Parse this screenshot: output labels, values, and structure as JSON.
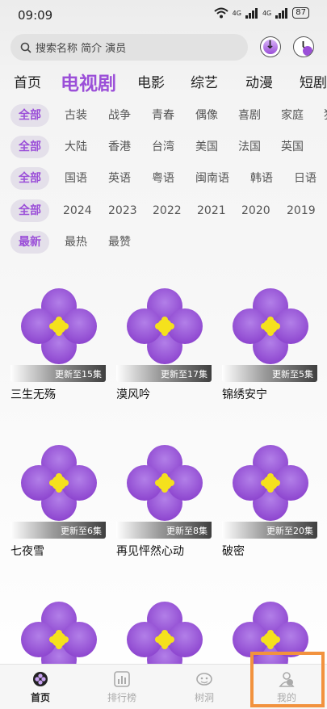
{
  "status_bar": {
    "time": "09:09",
    "network_1": "4G",
    "network_2": "4G",
    "battery": "87"
  },
  "search": {
    "placeholder": "搜索名称 简介 演员"
  },
  "icons": {
    "download": "download-icon",
    "history": "history-clock-icon",
    "search": "search-icon"
  },
  "category_tabs": [
    {
      "label": "首页",
      "active": false
    },
    {
      "label": "电视剧",
      "active": true
    },
    {
      "label": "电影",
      "active": false
    },
    {
      "label": "综艺",
      "active": false
    },
    {
      "label": "动漫",
      "active": false
    },
    {
      "label": "短剧",
      "active": false
    }
  ],
  "filters": {
    "genre": [
      "全部",
      "古装",
      "战争",
      "青春",
      "偶像",
      "喜剧",
      "家庭",
      "犯罪"
    ],
    "region": [
      "全部",
      "大陆",
      "香港",
      "台湾",
      "美国",
      "法国",
      "英国"
    ],
    "language": [
      "全部",
      "国语",
      "英语",
      "粤语",
      "闽南语",
      "韩语",
      "日语"
    ],
    "year": [
      "全部",
      "2024",
      "2023",
      "2022",
      "2021",
      "2020",
      "2019"
    ],
    "sort": [
      "最新",
      "最热",
      "最赞"
    ]
  },
  "shows": [
    {
      "title": "三生无殇",
      "episode": "更新至15集"
    },
    {
      "title": "漠风吟",
      "episode": "更新至17集"
    },
    {
      "title": "锦绣安宁",
      "episode": "更新至5集"
    },
    {
      "title": "七夜雪",
      "episode": "更新至6集"
    },
    {
      "title": "再见怦然心动",
      "episode": "更新至8集"
    },
    {
      "title": "破密",
      "episode": "更新至20集"
    },
    {
      "title": "",
      "episode": ""
    },
    {
      "title": "",
      "episode": ""
    },
    {
      "title": "",
      "episode": ""
    }
  ],
  "bottom_nav": [
    {
      "label": "首页",
      "icon": "home-icon",
      "active": true
    },
    {
      "label": "排行榜",
      "icon": "ranking-icon",
      "active": false
    },
    {
      "label": "树洞",
      "icon": "tree-hole-icon",
      "active": false
    },
    {
      "label": "我的",
      "icon": "profile-icon",
      "active": false
    }
  ],
  "colors": {
    "accent": "#9b4fd8",
    "highlight": "#f2923e",
    "flower": "#9b4fd8",
    "flower_center": "#f5e11d"
  }
}
